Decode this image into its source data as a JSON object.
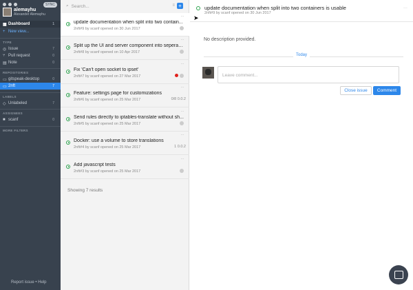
{
  "sidebar": {
    "sync_badge": "SYNC",
    "user": {
      "name": "alemayhu",
      "full_name": "Alexander Alemayhu"
    },
    "dashboard": {
      "label": "Dashboard",
      "count": "1"
    },
    "new_view": "New view...",
    "type_header": "TYPE",
    "types": [
      {
        "label": "Issue",
        "count": "7"
      },
      {
        "label": "Pull request",
        "count": "0"
      },
      {
        "label": "Note",
        "count": "0"
      }
    ],
    "repos_header": "REPOSITORIES",
    "repos": [
      {
        "label": "gitspeak-desktop",
        "count": "0"
      },
      {
        "label": "2nft",
        "count": "7"
      }
    ],
    "labels_header": "LABELS",
    "labels": [
      {
        "label": "Unlabeled",
        "count": "7"
      }
    ],
    "assignees_header": "ASSIGNEES",
    "assignees": [
      {
        "label": "scanf",
        "count": "0"
      }
    ],
    "more_filters": "MORE FILTERS",
    "footer": "Report issue • Help"
  },
  "list": {
    "search_placeholder": "Search...",
    "items": [
      {
        "title": "update documentation when split into two contain...",
        "sub": "2nft#9 by scanf opened on 30 Jun 2017"
      },
      {
        "title": "Split up the UI and server component into seperate...",
        "sub": "2nft#8 by scanf opened on 10 Apr 2017"
      },
      {
        "title": "Fix 'Can't open socket to ipset'",
        "sub": "2nft#7 by scanf opened on 27 Mar 2017"
      },
      {
        "title": "Feature: settings page for customizations",
        "sub": "2nft#6 by scanf opened on 25 Mar 2017",
        "meta": "0/8  0.0.2"
      },
      {
        "title": "Send rules directly to iptables-translate without sh...",
        "sub": "2nft#5 by scanf opened on 25 Mar 2017"
      },
      {
        "title": "Docker: use a volume to store translations",
        "sub": "2nft#4 by scanf opened on 25 Mar 2017",
        "meta": "1  0.0.2"
      },
      {
        "title": "Add javascript tests",
        "sub": "2nft#3 by scanf opened on 25 Mar 2017"
      }
    ],
    "showing": "Showing 7 results"
  },
  "detail": {
    "title": "update documentation when split into two containers is usable",
    "sub": "2nft#9 by scanf opened on 30 Jun 2017",
    "no_description": "No description provided.",
    "today": "Today",
    "comment_placeholder": "Leave comment...",
    "close_label": "Close issue",
    "comment_label": "Comment"
  },
  "colors": {
    "accent": "#2d87ea",
    "sidebar": "#38424e",
    "open": "#2ea44f",
    "red": "#e0201c"
  }
}
